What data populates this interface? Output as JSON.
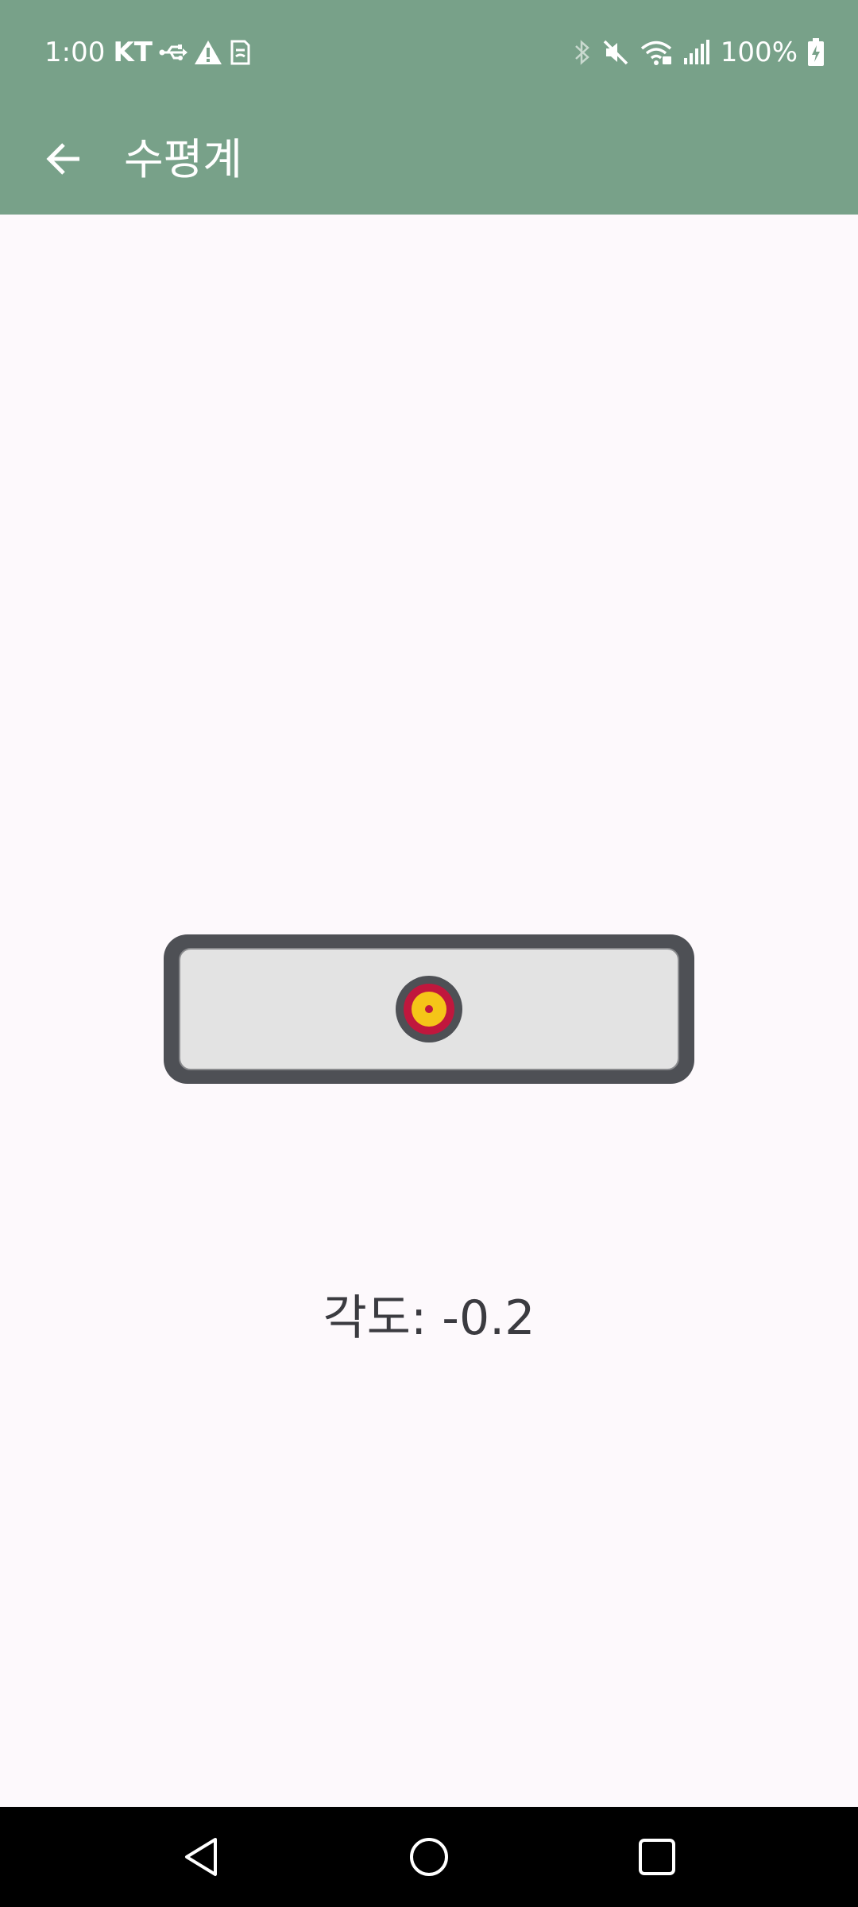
{
  "status_bar": {
    "time": "1:00",
    "carrier": "KT",
    "battery": "100%",
    "icons": [
      "usb-icon",
      "warning-icon",
      "sim-icon",
      "bluetooth-icon",
      "mute-icon",
      "wifi-icon",
      "signal-icon",
      "battery-charging-icon"
    ]
  },
  "app_bar": {
    "title": "수평계",
    "back_icon": "arrow-left-icon"
  },
  "level": {
    "angle_label": "각도: -0.2",
    "bubble_offset": -0.2
  },
  "nav_bar": {
    "icons": [
      "back-triangle-icon",
      "home-circle-icon",
      "recents-square-icon"
    ]
  },
  "colors": {
    "bar_background": "#78a189",
    "page_background": "#fdf9fc",
    "frame": "#4e5055",
    "tube": "#e3e3e3",
    "bubble_ring": "#c0173d",
    "bubble_fill": "#f5c518",
    "text": "#3b3b40"
  }
}
